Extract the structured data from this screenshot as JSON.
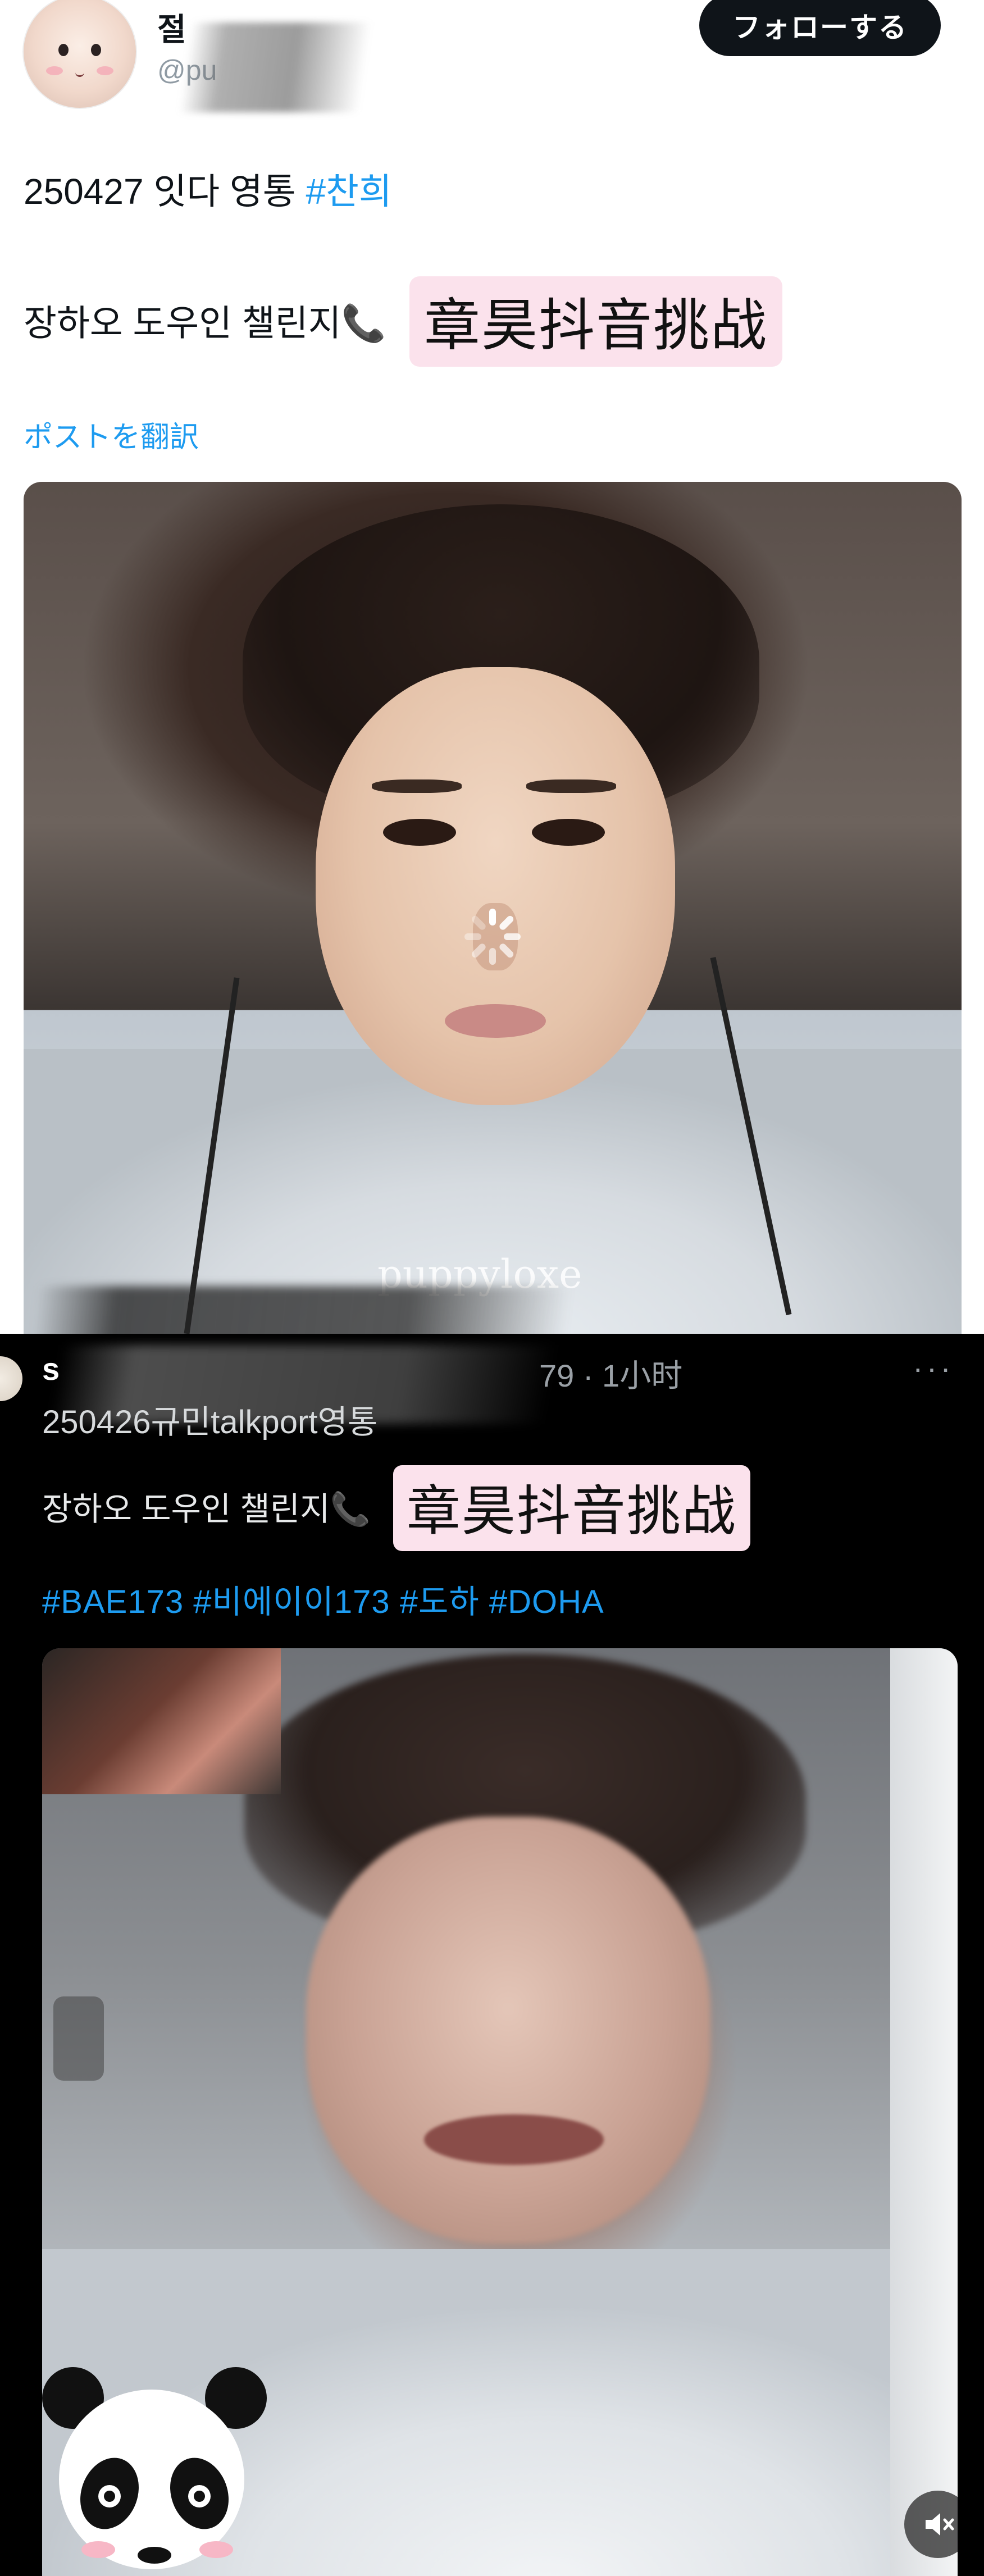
{
  "post_top": {
    "user_name": "절",
    "user_handle": "@pu",
    "follow_label": "フォローする",
    "line1_text": "250427 잇다 영통 ",
    "line1_hashtag": "#찬희",
    "line2_text": "장하오 도우인 챌린지",
    "line2_phone": "📞",
    "line2_highlight": "章昊抖音挑战",
    "translate_label": "ポストを翻訳",
    "watermark": "puppyloxe"
  },
  "post_bottom": {
    "user_name": "s",
    "meta": "79 · 1小时",
    "more_label": "···",
    "subtitle": "250426규민talkport영통",
    "line_text": "장하오 도우인 챌린지",
    "line_phone": "📞",
    "line_highlight": "章昊抖音挑战",
    "tags": "#BAE173 #비에이이173 #도하 #DOHA"
  },
  "colors": {
    "link": "#1d9bf0",
    "highlight_bg": "#fbe2ec",
    "follow_bg": "#0f1419",
    "dark_bg": "#000000"
  },
  "icons": [
    "phone-icon",
    "loading-spinner-icon",
    "mute-icon",
    "more-icon",
    "panda-sticker-icon"
  ]
}
